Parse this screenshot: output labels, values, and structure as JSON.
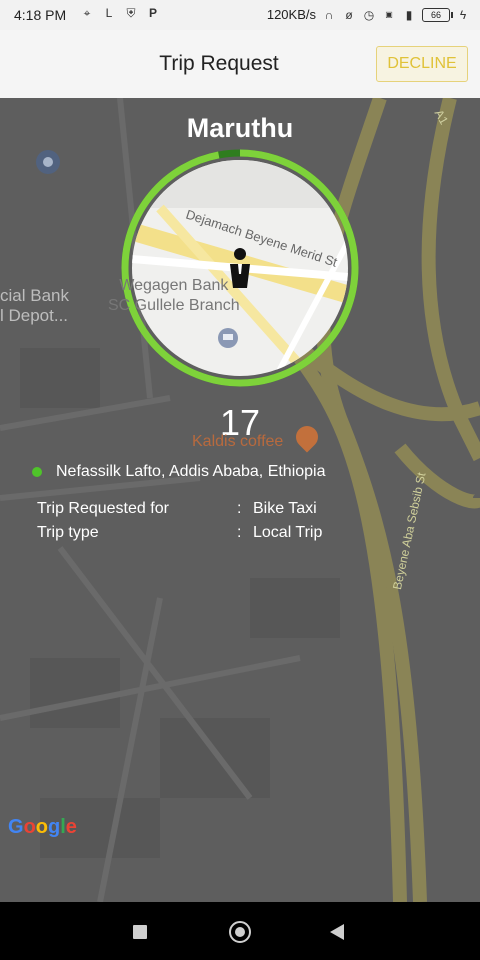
{
  "status_bar": {
    "time": "4:18 PM",
    "network_speed": "120KB/s",
    "battery": "66",
    "left_icons": [
      "location-icon",
      "lambda-icon",
      "shield-icon",
      "p-icon"
    ],
    "right_icons": [
      "headset-icon",
      "mute-icon",
      "alarm-icon",
      "volte-icon",
      "signal-icon",
      "charging-icon"
    ]
  },
  "app_bar": {
    "title": "Trip Request",
    "decline_label": "DECLINE"
  },
  "rider": {
    "name": "Maruthu",
    "countdown": "17",
    "countdown_progress": 0.97
  },
  "map_labels": {
    "bank_line1": "cial Bank",
    "bank_line2": "l Depot...",
    "inset_street": "Dejamach Beyene Merid St",
    "inset_poi_line1": "Wegagen Bank",
    "inset_poi_line2": "SC Gullele Branch",
    "kaldis": "Kaldis coffee",
    "street_right": "Beyene Aba Sebsib St",
    "road_a1": "A1",
    "google": [
      "G",
      "o",
      "o",
      "g",
      "l",
      "e"
    ]
  },
  "trip": {
    "address": "Nefassilk Lafto, Addis Ababa, Ethiopia",
    "details": [
      {
        "label": "Trip Requested for",
        "value": "Bike Taxi"
      },
      {
        "label": "Trip type",
        "value": "Local Trip"
      }
    ]
  },
  "colors": {
    "ring_progress": "#7ed23a",
    "ring_track": "#2f7d1e",
    "decline_text": "#e0c238",
    "address_dot": "#4fc42a"
  }
}
